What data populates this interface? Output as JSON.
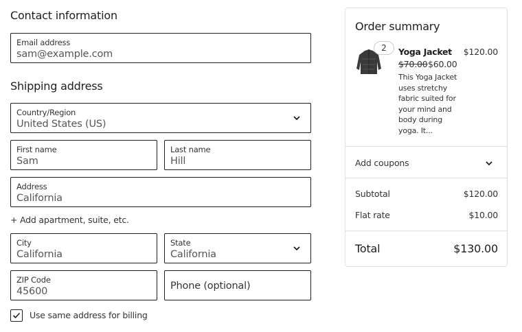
{
  "contact": {
    "heading": "Contact information",
    "email": {
      "label": "Email address",
      "value": "sam@example.com"
    }
  },
  "shipping": {
    "heading": "Shipping address",
    "country": {
      "label": "Country/Region",
      "value": "United States (US)"
    },
    "first_name": {
      "label": "First name",
      "value": "Sam"
    },
    "last_name": {
      "label": "Last name",
      "value": "Hill"
    },
    "address": {
      "label": "Address",
      "value": "California"
    },
    "add_apartment": "+ Add apartment, suite, etc.",
    "city": {
      "label": "City",
      "value": "California"
    },
    "state": {
      "label": "State",
      "value": "California"
    },
    "zip": {
      "label": "ZIP Code",
      "value": "45600"
    },
    "phone": {
      "placeholder": "Phone (optional)"
    },
    "same_billing": {
      "label": "Use same address for billing",
      "checked": true
    }
  },
  "summary": {
    "title": "Order summary",
    "item": {
      "quantity": "2",
      "name": "Yoga Jacket",
      "total": "$120.00",
      "regular_price": "$70.00",
      "sale_price": "$60.00",
      "description": "This Yoga Jacket uses stretchy fabric suited for your mind and body during yoga. It..."
    },
    "coupons_label": "Add coupons",
    "subtotal": {
      "label": "Subtotal",
      "value": "$120.00"
    },
    "shipping_rate": {
      "label": "Flat rate",
      "value": "$10.00"
    },
    "total": {
      "label": "Total",
      "value": "$130.00"
    }
  },
  "icons": {
    "chevron": "chevron-down-icon",
    "check": "check-icon",
    "product": "jacket-thumbnail"
  }
}
